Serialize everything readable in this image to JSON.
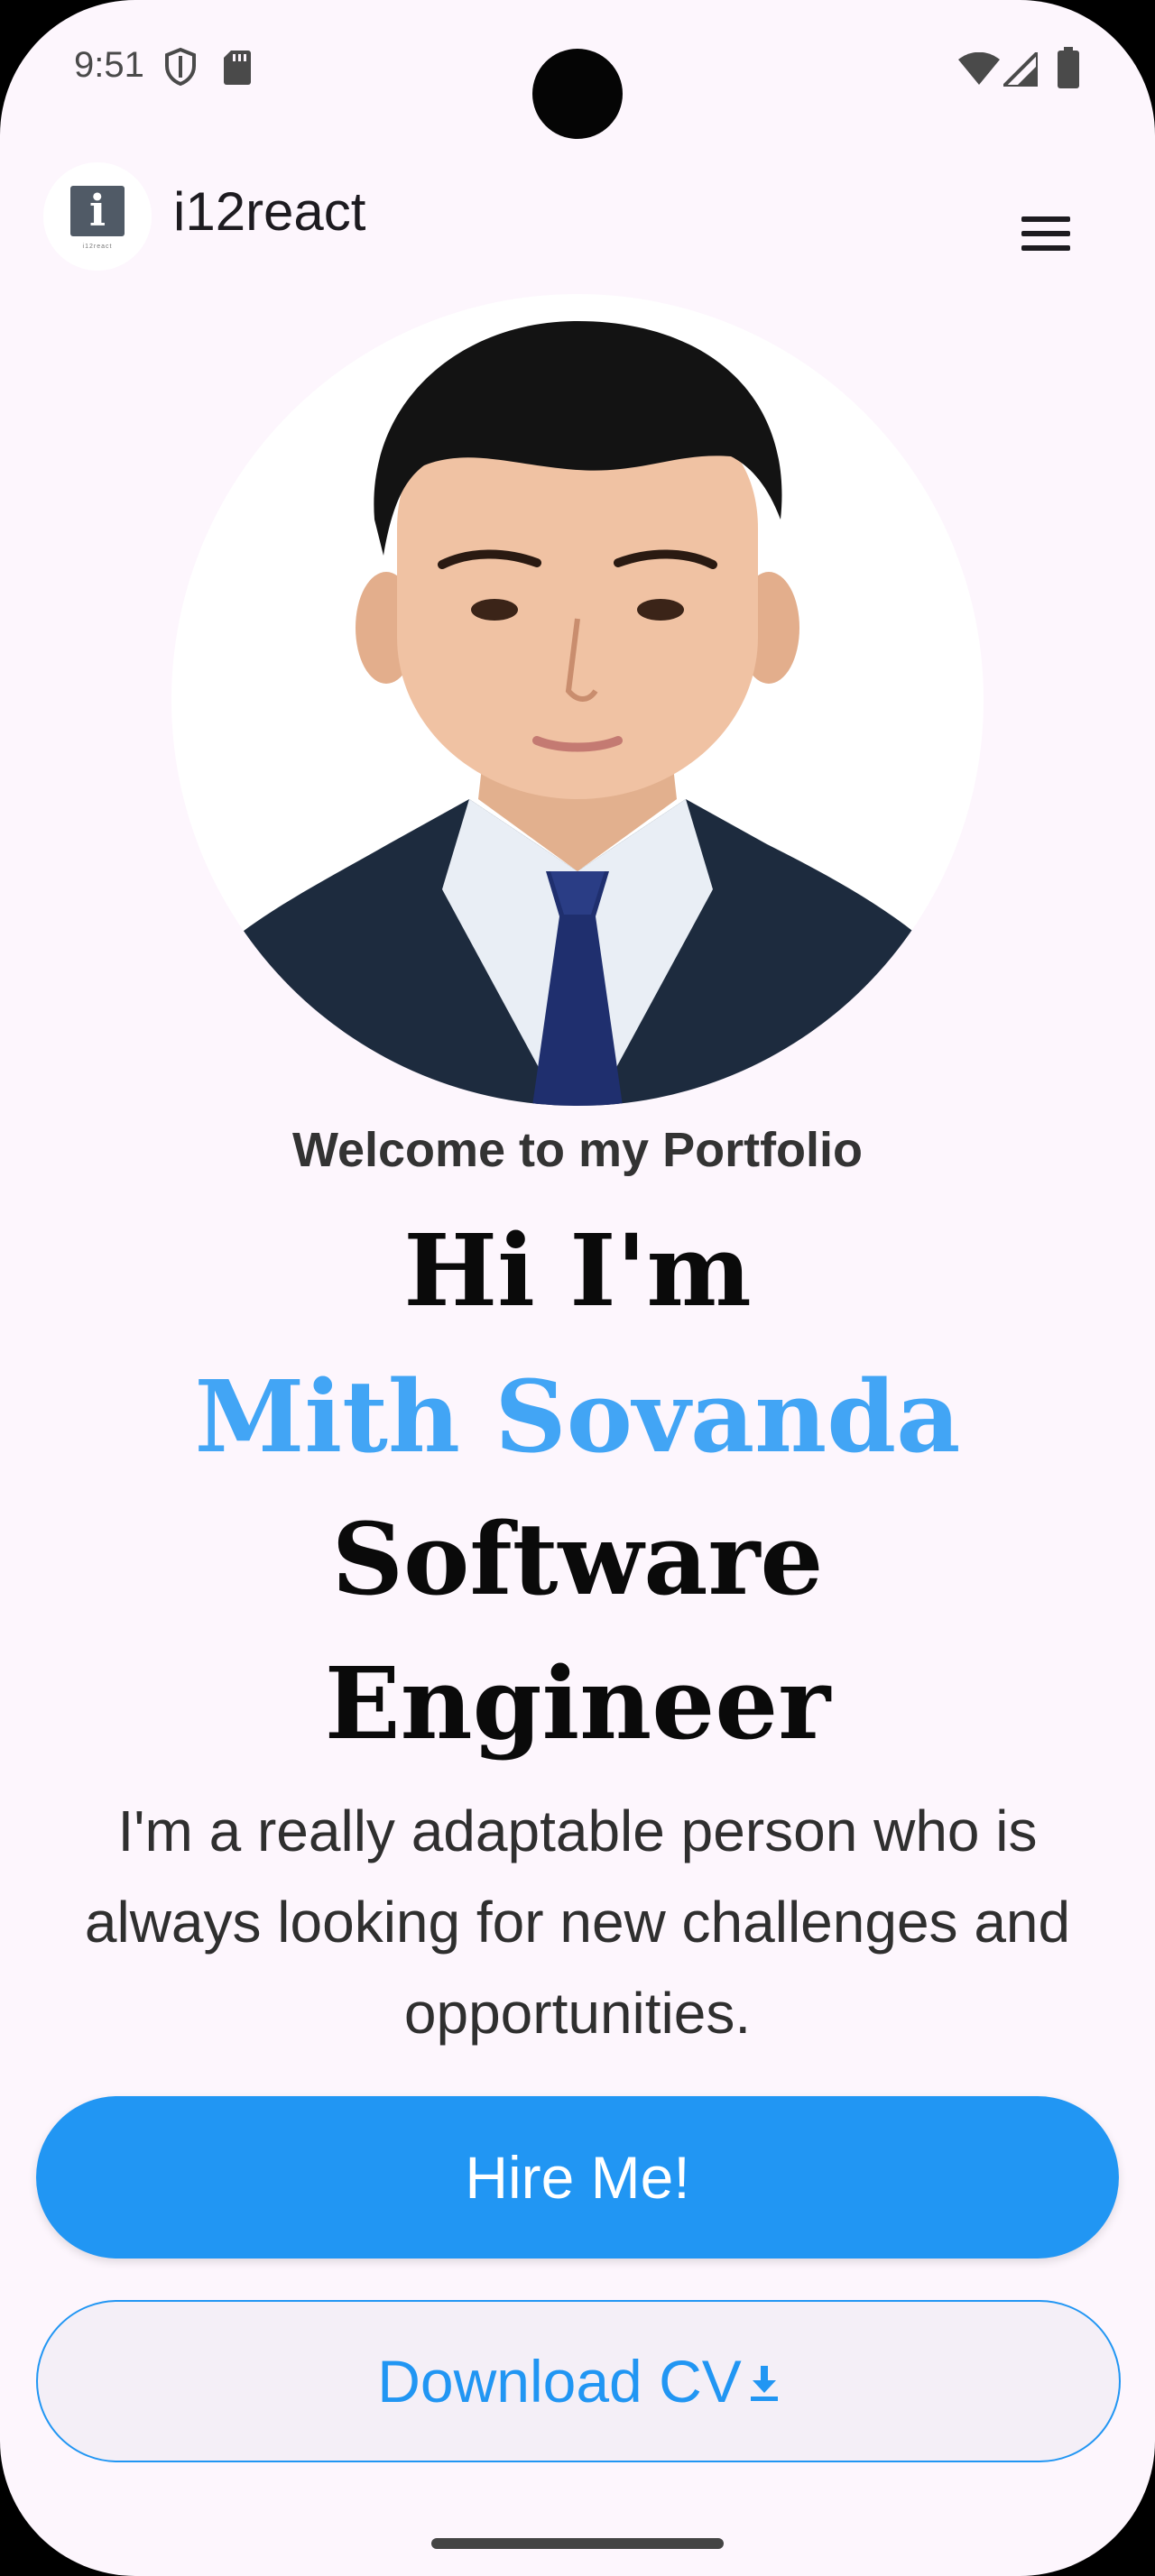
{
  "status_bar": {
    "time": "9:51",
    "icons": [
      "shield-icon",
      "sd-card-icon",
      "wifi-icon",
      "signal-icon",
      "battery-icon"
    ]
  },
  "app_bar": {
    "title": "i12react",
    "logo_letter": "i",
    "logo_sub": "i12react",
    "menu_icon": "hamburger-menu-icon"
  },
  "hero": {
    "welcome": "Welcome to my Portfolio",
    "greeting": "Hi I'm",
    "name": "Mith Sovanda",
    "role_line1": "Software",
    "role_line2": "Engineer",
    "intro_line1": "I'm a really adaptable person who is",
    "intro_line2": "always looking for new challenges and",
    "intro_line3": "opportunities."
  },
  "actions": {
    "hire_label": "Hire Me!",
    "download_label": "Download CV",
    "download_icon": "download-icon"
  },
  "colors": {
    "background": "#fdf6fd",
    "accent": "#2196f3",
    "name": "#42a5f5"
  }
}
